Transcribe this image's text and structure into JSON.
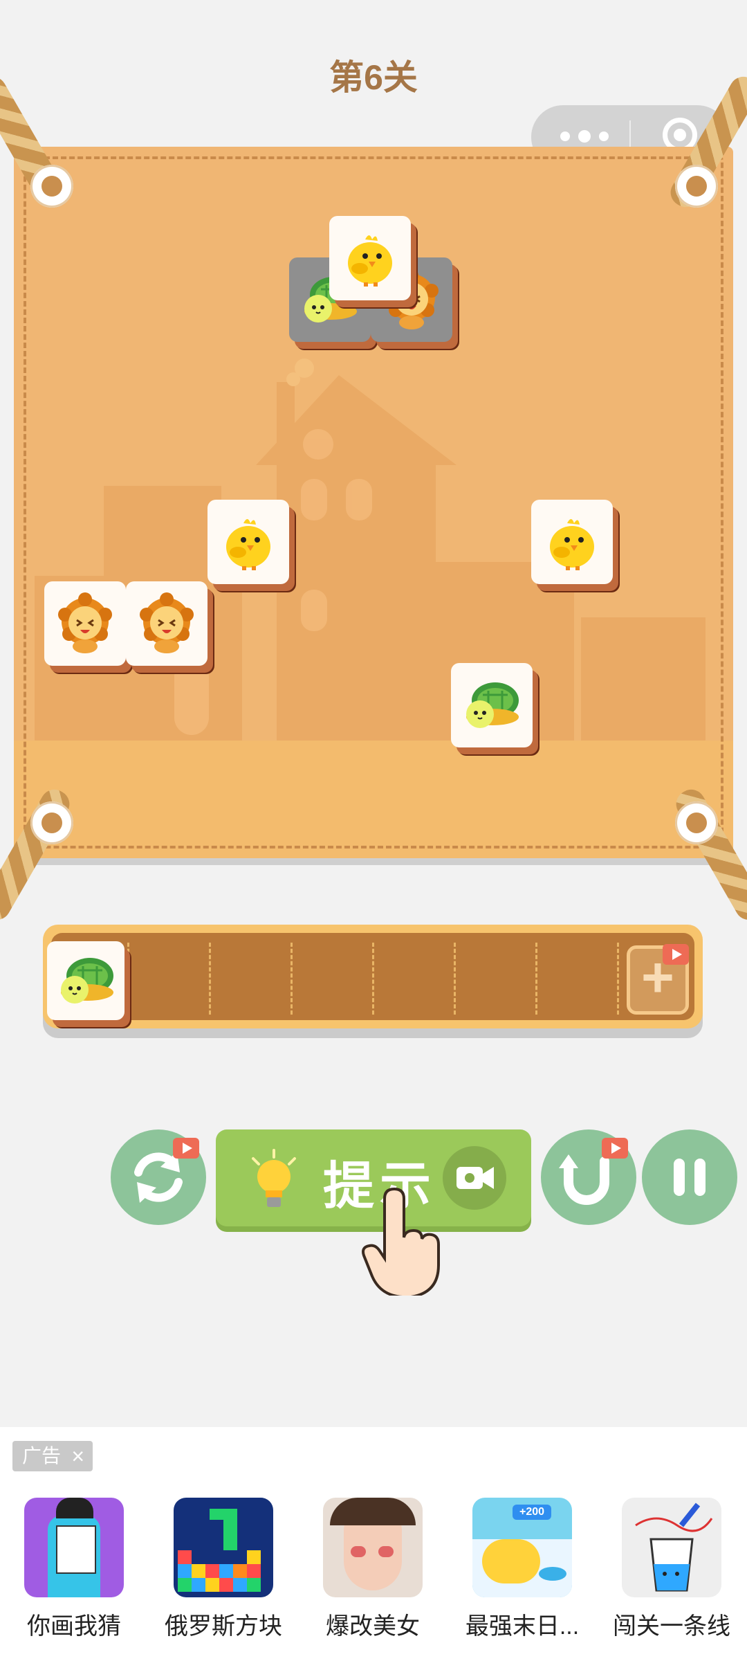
{
  "level_title": "第6关",
  "capsule": {
    "more_icon": "more-dots-icon",
    "close_icon": "target-circle-icon"
  },
  "board": {
    "tiles": [
      {
        "animal": "turtle",
        "row": "top",
        "covered": true
      },
      {
        "animal": "lion",
        "row": "top",
        "covered": true
      },
      {
        "animal": "chick",
        "row": "top",
        "covered": false
      },
      {
        "animal": "chick",
        "covered": false
      },
      {
        "animal": "chick",
        "covered": false
      },
      {
        "animal": "lion",
        "covered": false
      },
      {
        "animal": "lion",
        "covered": false
      },
      {
        "animal": "turtle",
        "covered": false
      }
    ]
  },
  "tray": {
    "slots": 7,
    "filled": [
      "turtle"
    ],
    "add_label": "+"
  },
  "controls": {
    "shuffle_icon": "shuffle-icon",
    "hint_label": "提示",
    "undo_icon": "undo-icon",
    "pause_icon": "pause-icon"
  },
  "ad": {
    "tag": "广告",
    "close": "×",
    "apps": [
      {
        "name": "你画我猜"
      },
      {
        "name": "俄罗斯方块"
      },
      {
        "name": "爆改美女"
      },
      {
        "name": "最强末日..."
      },
      {
        "name": "闯关一条线"
      }
    ],
    "banner_number": "+200"
  },
  "colors": {
    "board": "#f0b673",
    "hint_button": "#9bc95a",
    "round_button": "#8dc49a",
    "title": "#a57647"
  }
}
